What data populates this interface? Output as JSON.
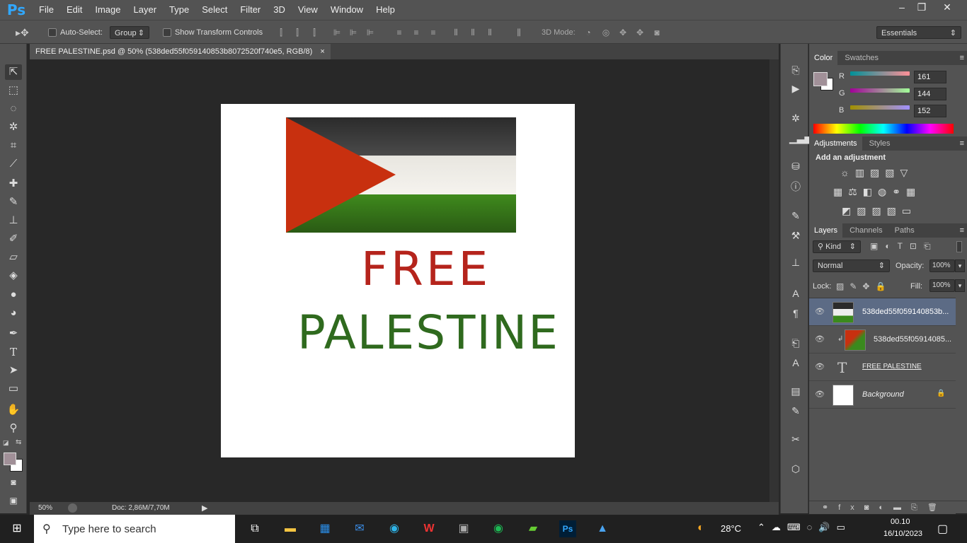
{
  "app": {
    "logo": "Ps"
  },
  "menu": [
    "File",
    "Edit",
    "Image",
    "Layer",
    "Type",
    "Select",
    "Filter",
    "3D",
    "View",
    "Window",
    "Help"
  ],
  "window_controls": {
    "minimize": "–",
    "maximize": "❐",
    "close": "✕"
  },
  "options": {
    "auto_select_label": "Auto-Select:",
    "auto_select_value": "Group",
    "show_transform_label": "Show Transform Controls",
    "mode_3d_label": "3D Mode:",
    "workspace": "Essentials"
  },
  "document": {
    "tab_title": "FREE PALESTINE.psd @ 50% (538ded55f059140853b8072520f740e5, RGB/8)",
    "tab_close": "×",
    "text_line1": "FREE",
    "text_line2": "PALESTINE"
  },
  "status": {
    "zoom": "50%",
    "doc_info": "Doc: 2,86M/7,70M"
  },
  "color_panel": {
    "tabs": [
      "Color",
      "Swatches"
    ],
    "r_label": "R",
    "g_label": "G",
    "b_label": "B",
    "r": "161",
    "g": "144",
    "b": "152",
    "fg": "#a19098"
  },
  "adjustments_panel": {
    "tabs": [
      "Adjustments",
      "Styles"
    ],
    "heading": "Add an adjustment"
  },
  "layers_panel": {
    "tabs": [
      "Layers",
      "Channels",
      "Paths"
    ],
    "kind_label": "Kind",
    "blend_mode": "Normal",
    "opacity_label": "Opacity:",
    "opacity": "100%",
    "lock_label": "Lock:",
    "fill_label": "Fill:",
    "fill": "100%",
    "layers": [
      {
        "name": "538ded55f059140853b..."
      },
      {
        "name": "538ded55f05914085..."
      },
      {
        "name": "FREE  PALESTINE"
      },
      {
        "name": "Background"
      }
    ]
  },
  "taskbar": {
    "search_placeholder": "Type here to search",
    "weather": "28°C",
    "time": "00.10",
    "date": "16/10/2023"
  }
}
